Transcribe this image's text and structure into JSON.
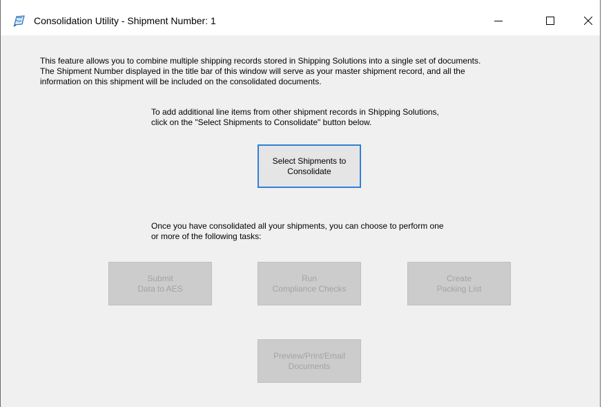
{
  "window": {
    "title": "Consolidation Utility - Shipment Number: 1",
    "icon": "consolidation-utility-icon"
  },
  "controls": {
    "minimize": "minimize-icon",
    "maximize": "maximize-icon",
    "close": "close-icon"
  },
  "intro_text": "This feature allows you to combine multiple shipping records stored in Shipping Solutions into a single set of documents.\nThe Shipment Number displayed in the title bar of this window will serve as your master shipment record, and all the\ninformation on this shipment will be included on the consolidated documents.",
  "add_instructions": "To add additional line items from other shipment records in Shipping Solutions,\nclick on the \"Select Shipments to Consolidate\" button below.",
  "select_button": "Select Shipments to\nConsolidate",
  "tasks_instructions": "Once you have consolidated all your shipments, you can choose to perform one\nor more of the following tasks:",
  "task_buttons": {
    "submit_aes": "Submit\nData to AES",
    "compliance": "Run\nCompliance Checks",
    "packing_list": "Create\nPacking List",
    "preview": "Preview/Print/Email\nDocuments"
  },
  "colors": {
    "focus_border": "#2f7fd6",
    "disabled_text": "#a3a3a3",
    "window_bg": "#f0f0f0"
  }
}
